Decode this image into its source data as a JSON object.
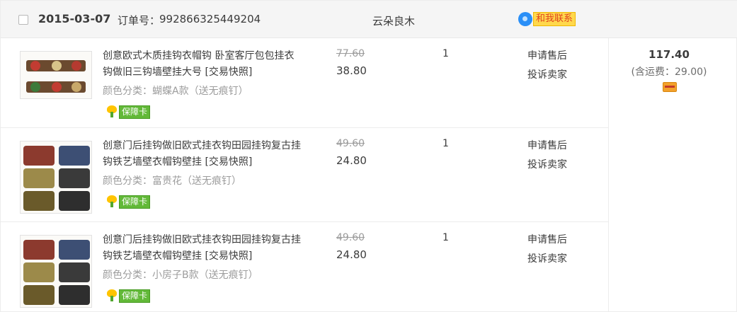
{
  "order": {
    "date": "2015-03-07",
    "order_no_label": "订单号：",
    "order_no": "992866325449204",
    "shop_name": "云朵良木",
    "contact_label": "和我联系",
    "total": "117.40",
    "shipping_note": "(含运费：29.00)"
  },
  "items": [
    {
      "title": "创意欧式木质挂钩衣帽钩 卧室客厅包包挂衣钩做旧三钩墙壁挂大号 [交易快照]",
      "variant": "颜色分类：蝴蝶A款（送无痕钉）",
      "badge": "保障卡",
      "price_old": "77.60",
      "price_new": "38.80",
      "qty": "1",
      "action1": "申请售后",
      "action2": "投诉卖家"
    },
    {
      "title": "创意门后挂钩做旧欧式挂衣钩田园挂钩复古挂钩铁艺墙壁衣帽钩壁挂 [交易快照]",
      "variant": "颜色分类：富贵花（送无痕钉）",
      "badge": "保障卡",
      "price_old": "49.60",
      "price_new": "24.80",
      "qty": "1",
      "action1": "申请售后",
      "action2": "投诉卖家"
    },
    {
      "title": "创意门后挂钩做旧欧式挂衣钩田园挂钩复古挂钩铁艺墙壁衣帽钩壁挂 [交易快照]",
      "variant": "颜色分类：小房子B款（送无痕钉）",
      "badge": "保障卡",
      "price_old": "49.60",
      "price_new": "24.80",
      "qty": "1",
      "action1": "申请售后",
      "action2": "投诉卖家"
    }
  ],
  "icons": {
    "checkbox": "checkbox-icon",
    "contact": "chat-bubble-icon",
    "badge": "guarantee-card-icon",
    "payment": "credit-card-icon"
  },
  "colors": {
    "header_bg": "#f5f5f5",
    "contact_bg": "#ffd84d",
    "contact_text": "#e0431e",
    "badge_bg": "#62b938"
  }
}
